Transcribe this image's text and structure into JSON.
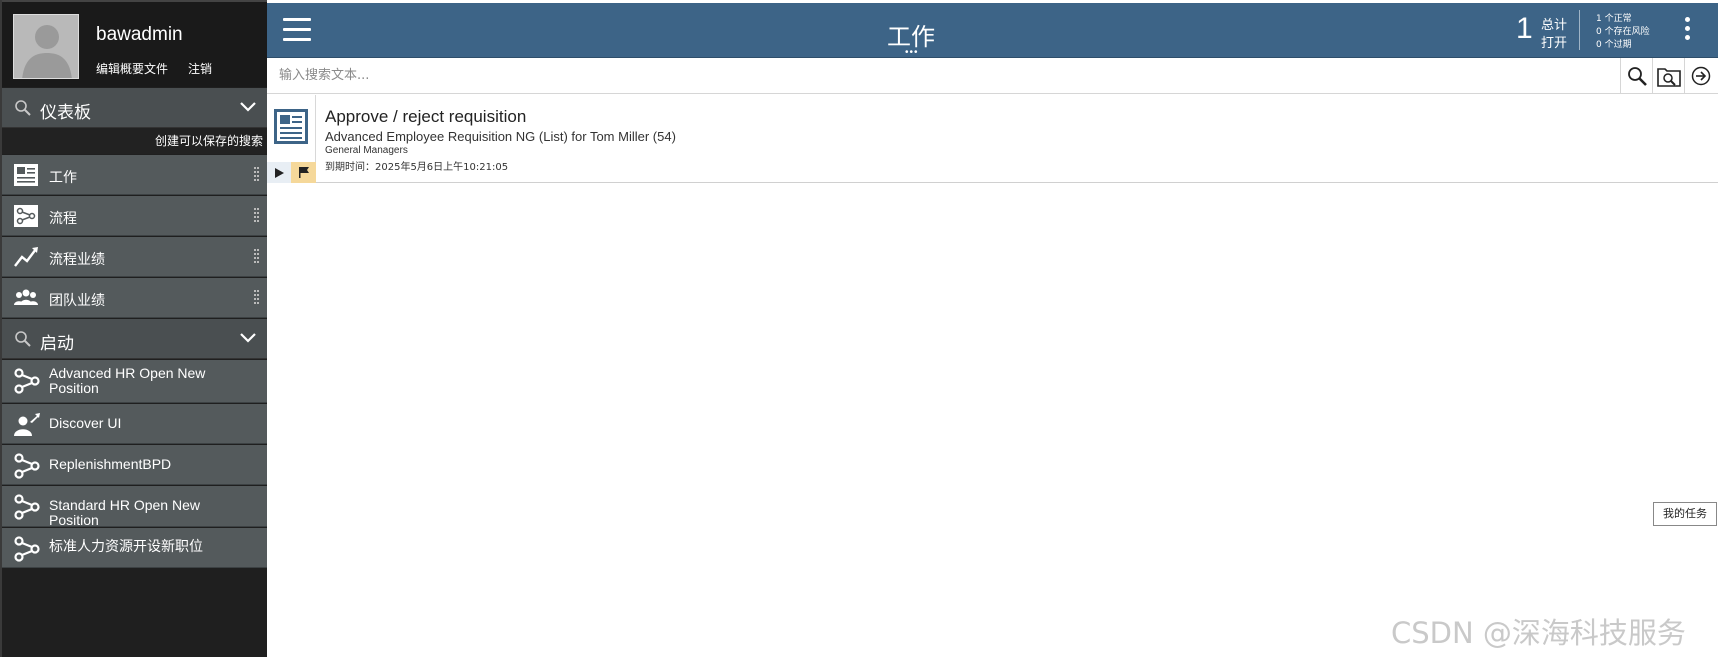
{
  "profile": {
    "username": "bawadmin",
    "edit_profile": "编辑概要文件",
    "logout": "注销"
  },
  "dashboards": {
    "title": "仪表板",
    "create_search": "创建可以保存的搜索",
    "items": [
      {
        "label": "工作",
        "icon": "work-list-icon"
      },
      {
        "label": "流程",
        "icon": "process-icon"
      },
      {
        "label": "流程业绩",
        "icon": "performance-chart-icon"
      },
      {
        "label": "团队业绩",
        "icon": "team-icon"
      }
    ]
  },
  "launch": {
    "title": "启动",
    "items": [
      {
        "label": "Advanced HR Open New Position",
        "icon": "process-flow-icon"
      },
      {
        "label": "Discover UI",
        "icon": "user-launch-icon"
      },
      {
        "label": "ReplenishmentBPD",
        "icon": "process-flow-icon"
      },
      {
        "label": "Standard HR Open New Position",
        "icon": "process-flow-icon"
      },
      {
        "label": "标准人力资源开设新职位",
        "icon": "process-flow-icon"
      }
    ]
  },
  "header": {
    "title": "工作",
    "title_dots": "•••",
    "count": "1",
    "total_label": "总计",
    "open_label": "打开",
    "status": [
      "1 个正常",
      "0 个存在风险",
      "0 个过期"
    ],
    "accent_color": "#3d6487"
  },
  "search": {
    "placeholder": "输入搜索文本..."
  },
  "task": {
    "title": "Approve / reject requisition",
    "subject": "Advanced Employee Requisition NG (List) for Tom Miller (54)",
    "team": "General Managers",
    "due": "到期时间：2025年5月6日上午10:21:05"
  },
  "my_tasks_label": "我的任务",
  "watermark": "CSDN @深海科技服务"
}
